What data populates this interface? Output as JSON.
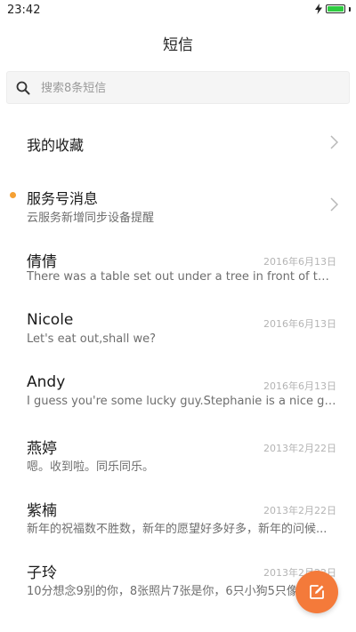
{
  "status_bar": {
    "time": "23:42",
    "battery_level": 1.0
  },
  "header": {
    "title": "短信"
  },
  "search": {
    "placeholder": "搜索8条短信"
  },
  "favorites": {
    "label": "我的收藏"
  },
  "service": {
    "title": "服务号消息",
    "subtitle": "云服务新增同步设备提醒",
    "unread": true
  },
  "conversations": [
    {
      "name": "倩倩",
      "date": "2016年6月13日",
      "preview": "There was a table set out under a tree in front of the ho..."
    },
    {
      "name": "Nicole",
      "date": "2016年6月13日",
      "preview": "Let's eat out,shall we?"
    },
    {
      "name": "Andy",
      "date": "2016年6月13日",
      "preview": "I guess you're some lucky guy.Stephanie is a nice girl."
    },
    {
      "name": "燕婷",
      "date": "2013年2月22日",
      "preview": "嗯。收到啦。同乐同乐。"
    },
    {
      "name": "紫楠",
      "date": "2013年2月22日",
      "preview": "新年的祝福数不胜数，新年的愿望好多好多，新年的问候..."
    },
    {
      "name": "子玲",
      "date": "2013年2月22日",
      "preview": "10分想念9别的你，8张照片7张是你，6只小狗5只像你"
    }
  ],
  "colors": {
    "accent": "#f47a3a",
    "unread_dot": "#f5a033",
    "battery": "#2ecc40"
  }
}
